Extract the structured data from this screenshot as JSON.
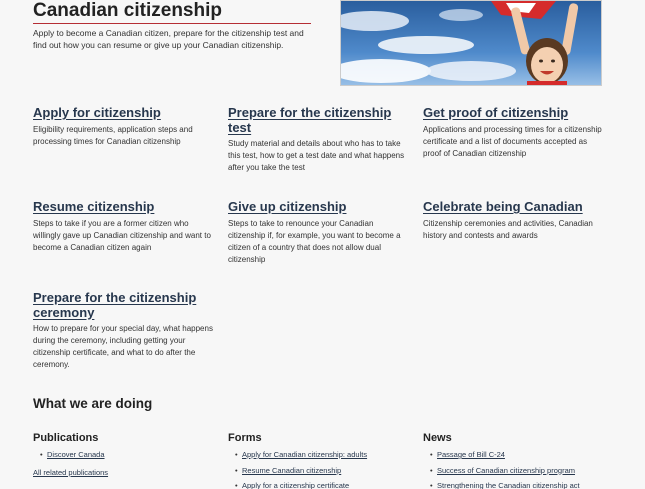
{
  "header": {
    "title": "Canadian citizenship",
    "intro": "Apply to become a Canadian citizen, prepare for the citizenship test and find out how you can resume or give up your Canadian citizenship."
  },
  "cards": [
    {
      "title": "Apply for citizenship",
      "desc": "Eligibility requirements, application steps and processing times for Canadian citizenship"
    },
    {
      "title": "Prepare for the citizenship test",
      "desc": "Study material and details about who has to take this test, how to get a test date and what happens after you take the test"
    },
    {
      "title": "Get proof of citizenship",
      "desc": "Applications and processing times for a citizenship certificate and a list of documents accepted as proof of Canadian citizenship"
    },
    {
      "title": "Resume citizenship",
      "desc": "Steps to take if you are a former citizen who willingly gave up Canadian citizenship and want to become a Canadian citizen again"
    },
    {
      "title": "Give up citizenship",
      "desc": "Steps to take to renounce your Canadian citizenship if, for example, you want to become a citizen of a country that does not allow dual citizenship"
    },
    {
      "title": "Celebrate being Canadian",
      "desc": "Citizenship ceremonies and activities, Canadian history and contests and awards"
    },
    {
      "title": "Prepare for the citizenship ceremony",
      "desc": "How to prepare for your special day, what happens during the ceremony, including getting your citizenship certificate, and what to do after the ceremony."
    }
  ],
  "doing": {
    "heading": "What we are doing",
    "publications": {
      "heading": "Publications",
      "items": [
        "Discover Canada"
      ],
      "all_link": "All related publications"
    },
    "forms": {
      "heading": "Forms",
      "items": [
        "Apply for Canadian citizenship: adults",
        "Resume Canadian citizenship",
        "Apply for a citizenship certificate"
      ]
    },
    "news": {
      "heading": "News",
      "items": [
        "Passage of Bill C-24",
        "Success of Canadian citizenship program",
        "Strengthening the Canadian citizenship act"
      ]
    }
  }
}
